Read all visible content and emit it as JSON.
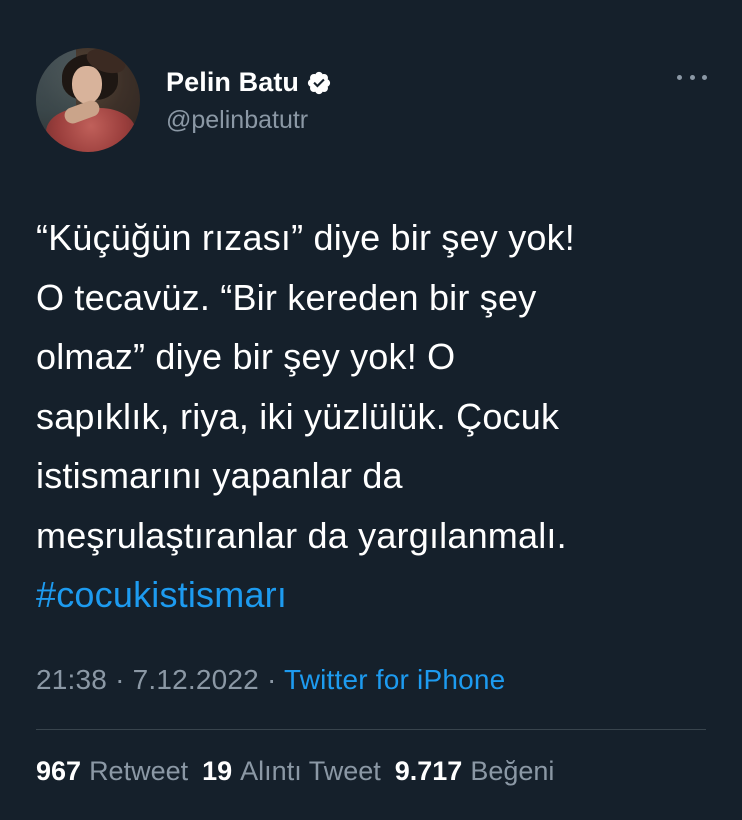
{
  "user": {
    "display_name": "Pelin Batu",
    "handle": "@pelinbatutr",
    "verified": true
  },
  "icons": {
    "verified": "verified-badge-icon",
    "more": "more-options-icon",
    "avatar": "profile-photo"
  },
  "tweet": {
    "lines": [
      "“Küçüğün rızası” diye bir şey yok!",
      "O tecavüz. “Bir kereden bir şey",
      "olmaz” diye bir şey yok! O",
      "sapıklık, riya, iki yüzlülük. Çocuk",
      "istismarını yapanlar da",
      "meşrulaştıranlar da yargılanmalı."
    ],
    "hashtag": "#cocukistismarı"
  },
  "meta": {
    "time": "21:38",
    "separator": "·",
    "date": "7.12.2022",
    "source": "Twitter for iPhone"
  },
  "stats": {
    "retweets_count": "967",
    "retweets_label": "Retweet",
    "quotes_count": "19",
    "quotes_label": "Alıntı Tweet",
    "likes_count": "9.717",
    "likes_label": "Beğeni"
  },
  "colors": {
    "background": "#15202b",
    "accent": "#1d9bf0",
    "secondary_text": "#8b98a5",
    "divider": "#38444d"
  }
}
